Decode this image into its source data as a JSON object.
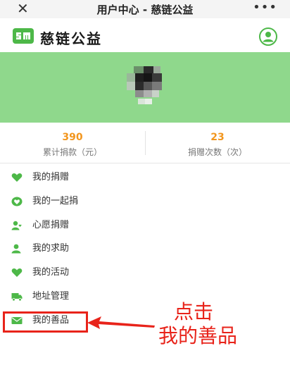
{
  "window": {
    "title": "用户中心 - 慈链公益",
    "close_glyph": "✕",
    "more_glyph": "•••"
  },
  "brand": {
    "name": "慈链公益",
    "logo_icon": "sm-logo-icon",
    "user_icon": "user-profile-icon",
    "accent_color": "#4db848"
  },
  "hero": {
    "background_color": "#8fd88c"
  },
  "stats": [
    {
      "value": "390",
      "label": "累计捐款（元）"
    },
    {
      "value": "23",
      "label": "捐赠次数（次）"
    }
  ],
  "menu": {
    "items": [
      {
        "label": "我的捐赠",
        "icon": "heart-icon"
      },
      {
        "label": "我的一起捐",
        "icon": "heart-circle-icon"
      },
      {
        "label": "心愿捐赠",
        "icon": "wish-person-icon"
      },
      {
        "label": "我的求助",
        "icon": "person-icon"
      },
      {
        "label": "我的活动",
        "icon": "heart-icon"
      },
      {
        "label": "地址管理",
        "icon": "truck-icon"
      },
      {
        "label": "我的善品",
        "icon": "envelope-icon"
      }
    ]
  },
  "annotation": {
    "line1": "点击",
    "line2": "我的善品",
    "color": "#e8231a"
  }
}
